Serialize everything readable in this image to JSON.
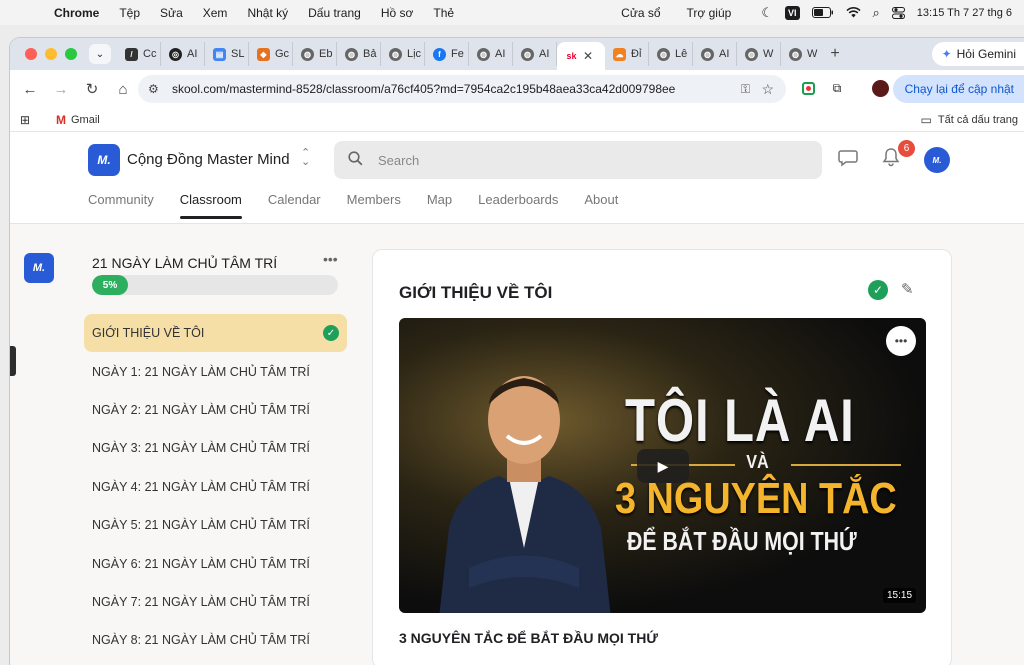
{
  "menubar": {
    "app": "Chrome",
    "items": [
      "Tệp",
      "Sửa",
      "Xem",
      "Nhật ký",
      "Dấu trang",
      "Hồ sơ",
      "Thẻ",
      "Cửa sổ",
      "Trợ giúp"
    ],
    "input_source": "VI",
    "clock": "13:15 Th 7 27 thg 6"
  },
  "tabs": [
    "Cc",
    "AI",
    "SL",
    "Gc",
    "Eb",
    "Bả",
    "Lịc",
    "Fe",
    "AI",
    "AI",
    "sk",
    "Đỉ",
    "Lê",
    "AI",
    "W",
    "W"
  ],
  "gemini_label": "Hỏi Gemini",
  "address": {
    "url": "skool.com/mastermind-8528/classroom/a76cf405?md=7954ca2c195b48aea33ca42d009798ee"
  },
  "update_label": "Chạy lại để cập nhật",
  "bookmarks": {
    "gmail": "Gmail",
    "all": "Tất cả dấu trang"
  },
  "header": {
    "group_name": "Cộng Đồng Master Mind",
    "search_placeholder": "Search",
    "notification_count": "6",
    "logo_text": "M."
  },
  "nav": {
    "tabs": [
      "Community",
      "Classroom",
      "Calendar",
      "Members",
      "Map",
      "Leaderboards",
      "About"
    ],
    "active": "Classroom"
  },
  "course": {
    "title": "21 NGÀY LÀM CHỦ TÂM TRÍ",
    "progress": 0.05,
    "progress_label": "5%",
    "lessons": [
      "GIỚI THIỆU VỀ TÔI",
      "NGÀY 1: 21 NGÀY LÀM CHỦ TÂM TRÍ",
      "NGÀY 2: 21 NGÀY LÀM CHỦ TÂM TRÍ",
      "NGÀY 3: 21 NGÀY LÀM CHỦ TÂM TRÍ",
      "NGÀY 4: 21 NGÀY LÀM CHỦ TÂM TRÍ",
      "NGÀY 5: 21 NGÀY LÀM CHỦ TÂM TRÍ",
      "NGÀY 6: 21 NGÀY LÀM CHỦ TÂM TRÍ",
      "NGÀY 7: 21 NGÀY LÀM CHỦ TÂM TRÍ",
      "NGÀY 8: 21 NGÀY LÀM CHỦ TÂM TRÍ"
    ]
  },
  "lesson": {
    "heading": "GIỚI THIỆU VỀ TÔI",
    "video_line1": "TÔI LÀ AI",
    "video_line2": "VÀ",
    "video_line3": "3 NGUYÊN TẮC",
    "video_line4": "ĐỂ BẮT ĐẦU MỌI THỨ",
    "duration": "15:15",
    "video_title": "3 NGUYÊN TẮC ĐỂ BẮT ĐẦU MỌI THỨ"
  },
  "colors": {
    "brand": "#2a5bd7",
    "progress": "#2eaf5f",
    "active_lesson": "#f5dfa7",
    "accent_gold": "#f4b52c"
  }
}
